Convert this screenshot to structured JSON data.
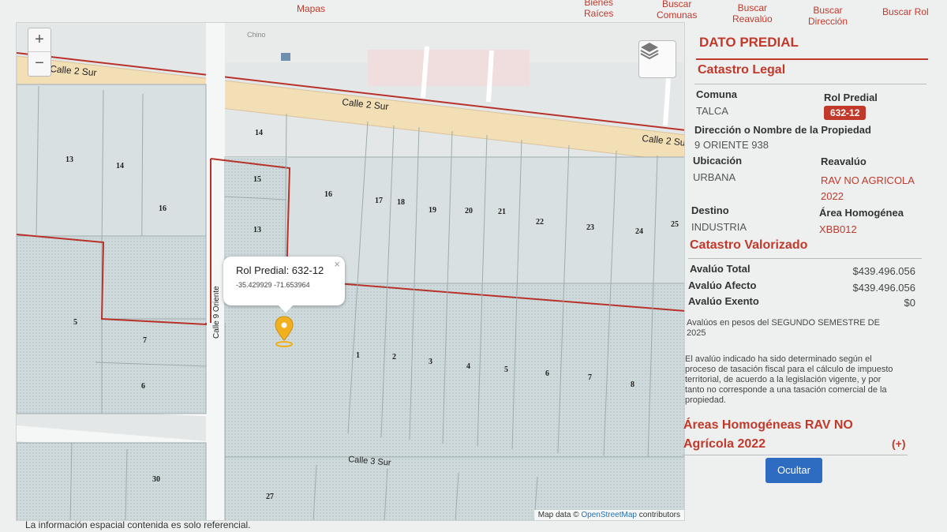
{
  "nav": {
    "mapas": "Mapas",
    "bienes_line1": "Bienes",
    "bienes_line2": "Raíces",
    "comunas_line1": "Buscar",
    "comunas_line2": "Comunas",
    "reavaluo_line1": "Buscar",
    "reavaluo_line2": "Reavalúo",
    "direccion_line1": "Buscar",
    "direccion_line2": "Dirección",
    "rol": "Buscar Rol"
  },
  "map": {
    "zoom_in": "+",
    "zoom_out": "−",
    "streets": {
      "calle2sur_a": "Calle 2 Sur",
      "calle2sur_b": "Calle 2 Sur",
      "calle2sur_c": "Calle 2 Su",
      "calle3sur": "Calle 3 Sur",
      "oriente": "Calle 9 Oriente",
      "chino": "Chino"
    },
    "lot_numbers": [
      "13",
      "14",
      "16",
      "14",
      "15",
      "13",
      "16",
      "17",
      "18",
      "19",
      "20",
      "21",
      "22",
      "23",
      "24",
      "25",
      "5",
      "7",
      "6",
      "1",
      "2",
      "3",
      "4",
      "5",
      "6",
      "7",
      "8",
      "30",
      "27"
    ],
    "popup": {
      "title": "Rol Predial: 632-12",
      "coords": "-35.429929   -71.653964",
      "close": "×"
    },
    "attribution_prefix": "Map data © ",
    "attribution_link": "OpenStreetMap",
    "attribution_suffix": " contributors",
    "disclaimer": "La información espacial contenida es solo referencial."
  },
  "panel": {
    "title": "DATO PREDIAL",
    "legal_title": "Catastro Legal",
    "comuna_label": "Comuna",
    "comuna_value": "TALCA",
    "rol_label": "Rol Predial",
    "rol_value": "632-12",
    "direccion_label": "Dirección o Nombre de la Propiedad",
    "direccion_value": "9 ORIENTE 938",
    "ubicacion_label": "Ubicación",
    "ubicacion_value": "URBANA",
    "reavaluo_label": "Reavalúo",
    "reavaluo_value_1": "RAV NO AGRICOLA",
    "reavaluo_value_2": "2022",
    "destino_label": "Destino",
    "destino_value": "INDUSTRIA",
    "area_label": "Área Homogénea",
    "area_value": "XBB012",
    "valorizado_title": "Catastro Valorizado",
    "avaluo_total_label": "Avalúo Total",
    "avaluo_total_value": "$439.496.056",
    "avaluo_afecto_label": "Avalúo Afecto",
    "avaluo_afecto_value": "$439.496.056",
    "avaluo_exento_label": "Avalúo Exento",
    "avaluo_exento_value": "$0",
    "avaluos_note_1": "Avalúos en pesos del SEGUNDO SEMESTRE DE",
    "avaluos_note_2": "2025",
    "disclaimer_1": "El avalúo indicado ha sido determinado según el",
    "disclaimer_2": "proceso de tasación fiscal para el cálculo de impuesto",
    "disclaimer_3": "territorial, de acuerdo a la legislación vigente, y por",
    "disclaimer_4": "tanto no corresponde a una tasación comercial de la",
    "disclaimer_5": "propiedad.",
    "areas_title_1": "Áreas Homogéneas RAV NO",
    "areas_title_2": "Agrícola 2022",
    "expand": "(+)",
    "hide_button": "Ocultar"
  },
  "colors": {
    "accent": "#c0392b",
    "button": "#2d6cc0",
    "street": "#f3dfb6",
    "parcel": "#d6e0e2",
    "marker": "#f2b01e"
  }
}
